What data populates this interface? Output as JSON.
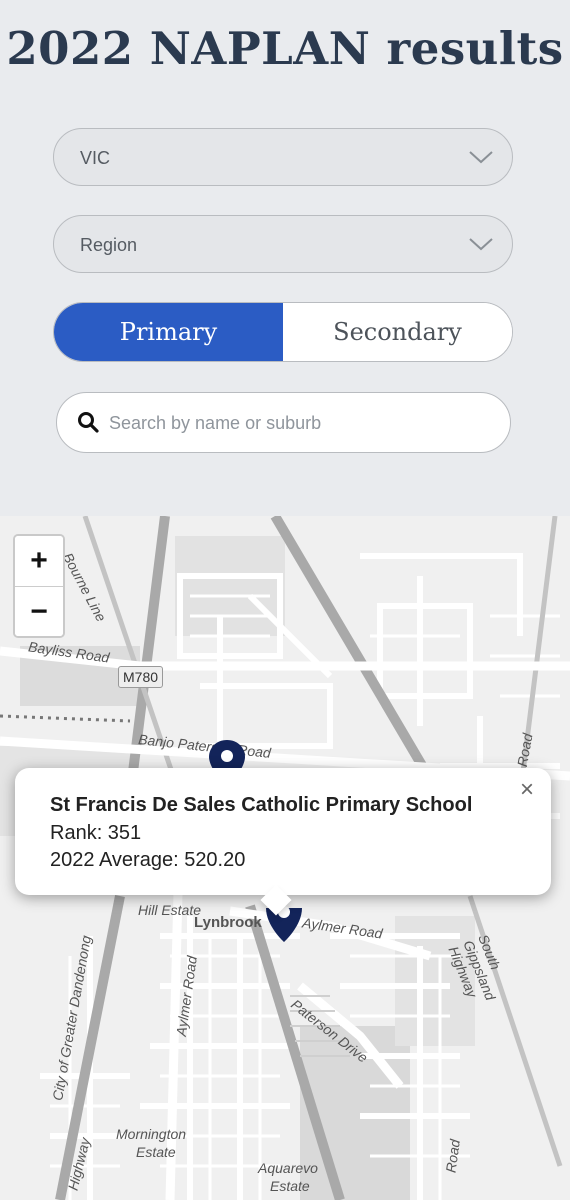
{
  "header": {
    "title": "2022 NAPLAN results"
  },
  "filters": {
    "state": {
      "value": "VIC",
      "icon": "chevron-down-icon"
    },
    "region": {
      "value": "Region",
      "icon": "chevron-down-icon"
    },
    "school_type": {
      "options": [
        "Primary",
        "Secondary"
      ],
      "selected": "Primary",
      "active_color": "#2b5cc4"
    },
    "search": {
      "placeholder": "Search by name or suburb",
      "icon": "search-icon",
      "value": ""
    }
  },
  "map": {
    "zoom_in": "+",
    "zoom_out": "−",
    "labels": {
      "bayliss": "Bayliss Road",
      "m780": "M780",
      "banjo": "Banjo Paterson Road",
      "bourne": "Bourne Line",
      "hill_estate": "Hill Estate",
      "lynbrook": "Lynbrook",
      "aylmer1": "Aylmer Road",
      "aylmer2": "Aylmer Road",
      "paterson": "Paterson Drive",
      "gippsland": "South Gippsland Highway",
      "dandenong": "City of Greater Dandenong",
      "mornington1": "Mornington",
      "mornington2": "Estate",
      "aquarevo1": "Aquarevo",
      "aquarevo2": "Estate",
      "highway": "Highway",
      "road_right": "Road",
      "road_bottom": "Road"
    },
    "marker_color": "#13245a",
    "popup": {
      "school_name": "St Francis De Sales Catholic Primary School",
      "rank": "Rank: 351",
      "average": "2022 Average: 520.20",
      "close": "×"
    }
  }
}
